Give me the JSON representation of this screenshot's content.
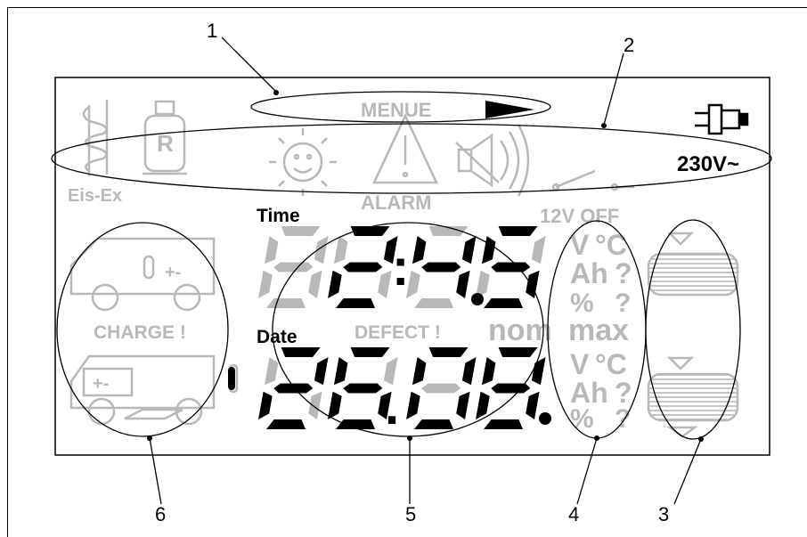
{
  "callouts": [
    "1",
    "2",
    "3",
    "4",
    "5",
    "6"
  ],
  "panel": {
    "menu_label": "MENUE",
    "ice_label": "Eis-Ex",
    "tank_letter": "R",
    "alarm_label": "ALARM",
    "switch_label": "12V OFF",
    "mains_label": "230V~",
    "time_label": "Time",
    "date_label": "Date",
    "charge_label": "CHARGE !",
    "defect_label": "DEFECT !",
    "nom_label": "nom",
    "max_label": "max",
    "battery_sign": "+-",
    "unit_top": [
      "V",
      "°C",
      "Ah",
      "?",
      "%",
      "?"
    ],
    "unit_bottom": [
      "V",
      "°C",
      "Ah",
      "?",
      "%",
      "?"
    ]
  },
  "display": {
    "time_digits": [
      "8",
      "2",
      "4",
      "5"
    ],
    "time_separator": ":",
    "date_digits": [
      "2",
      "6",
      "0",
      "8"
    ],
    "date_separator": "."
  },
  "colors": {
    "ink": "#000000",
    "inactive": "#b8b8b8",
    "background": "#ffffff"
  }
}
